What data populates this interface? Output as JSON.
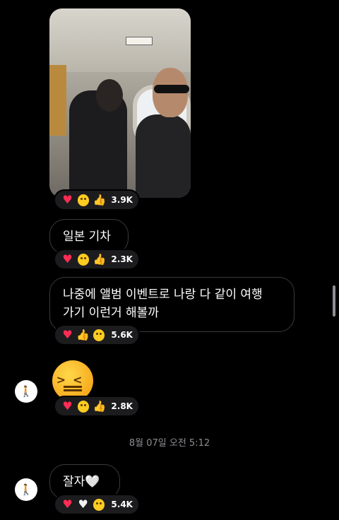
{
  "messages": {
    "photo": {
      "reactions": {
        "count": "3.9K"
      }
    },
    "msg1": {
      "text": "일본 기차",
      "reactions": {
        "count": "2.3K"
      }
    },
    "msg2": {
      "line1": "나중에 앨범 이벤트로 나랑 다 같이 여행",
      "line2": "가기 이런거 해볼까",
      "reactions": {
        "count": "5.6K"
      }
    },
    "emoji_msg": {
      "reactions": {
        "count": "2.8K"
      }
    },
    "timestamp": "8월 07일 오전 5:12",
    "msg3": {
      "text": "잘자🤍",
      "reactions": {
        "count": "5.4K"
      }
    }
  },
  "icons": {
    "heart": "red-heart-icon",
    "laugh": "laughing-face-icon",
    "thumb": "thumbs-up-icon",
    "surprised": "surprised-face-icon",
    "confounded": "confounded-face-icon",
    "white_heart": "white-heart-icon",
    "sleepy": "sleepy-face-icon"
  },
  "colors": {
    "background": "#000000",
    "bubble_border": "#3a3a3c",
    "reaction_bg": "#1c1c1e",
    "heart": "#ff2d55",
    "timestamp": "#8e8e93"
  }
}
